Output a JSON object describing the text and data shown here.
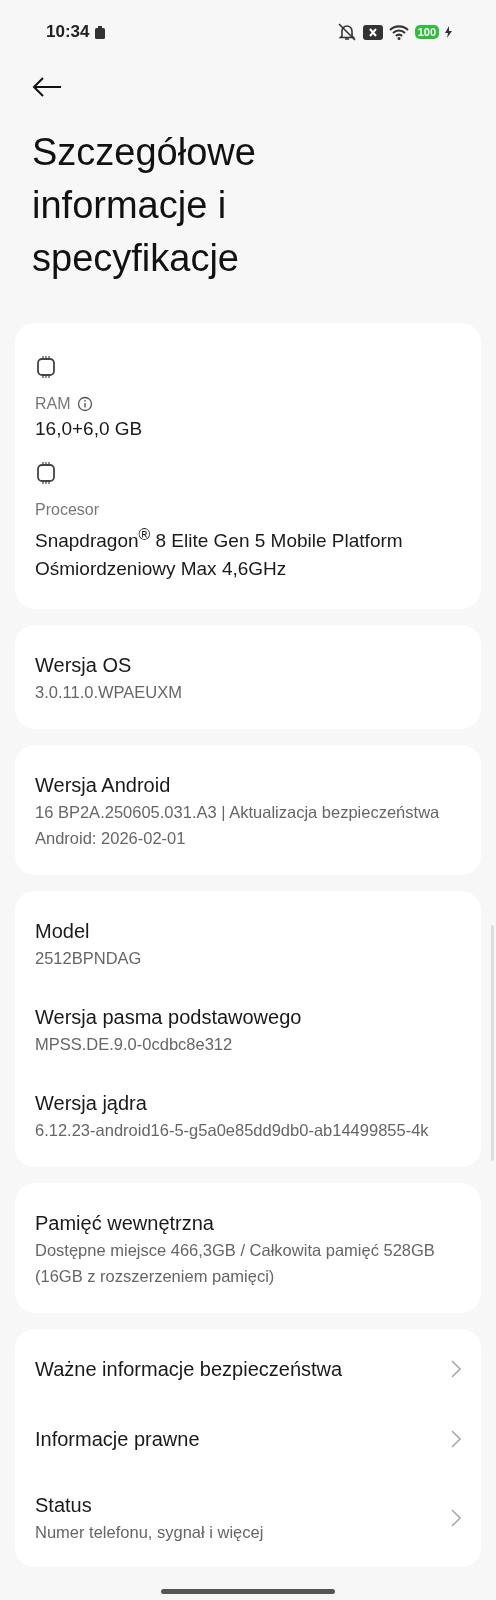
{
  "status_bar": {
    "time": "10:34",
    "battery": "100"
  },
  "title": "Szczegółowe informacje i specyfikacje",
  "cards": [
    {
      "items": [
        {
          "kind": "spec",
          "label": "RAM",
          "info": true,
          "value": "16,0+6,0 GB"
        },
        {
          "kind": "spec",
          "label": "Procesor",
          "info": false,
          "value": "Snapdragon$^{®}$ 8 Elite Gen 5 Mobile Platform Ośmiordzeniowy Max 4,6GHz"
        }
      ]
    },
    {
      "items": [
        {
          "kind": "info",
          "title": "Wersja OS",
          "value": "3.0.11.0.WPAEUXM"
        }
      ]
    },
    {
      "items": [
        {
          "kind": "info",
          "title": "Wersja Android",
          "value": "16 BP2A.250605.031.A3 | Aktualizacja bezpieczeństwa Android: 2026-02-01"
        }
      ]
    },
    {
      "items": [
        {
          "kind": "info",
          "title": "Model",
          "value": "2512BPNDAG"
        },
        {
          "kind": "info",
          "title": "Wersja pasma podstawowego",
          "value": "MPSS.DE.9.0-0cdbc8e312"
        },
        {
          "kind": "info",
          "title": "Wersja jądra",
          "value": "6.12.23-android16-5-g5a0e85dd9db0-ab14499855-4k"
        }
      ]
    },
    {
      "items": [
        {
          "kind": "info",
          "title": "Pamięć wewnętrzna",
          "value": "Dostępne miejsce  466,3GB / Całkowita pamięć 528GB (16GB z rozszerzeniem pamięci)"
        }
      ]
    },
    {
      "items": [
        {
          "kind": "link",
          "title": "Ważne informacje bezpieczeństwa"
        },
        {
          "kind": "link",
          "title": "Informacje prawne"
        },
        {
          "kind": "link",
          "title": "Status",
          "value": "Numer telefonu, sygnał i więcej"
        }
      ]
    }
  ]
}
